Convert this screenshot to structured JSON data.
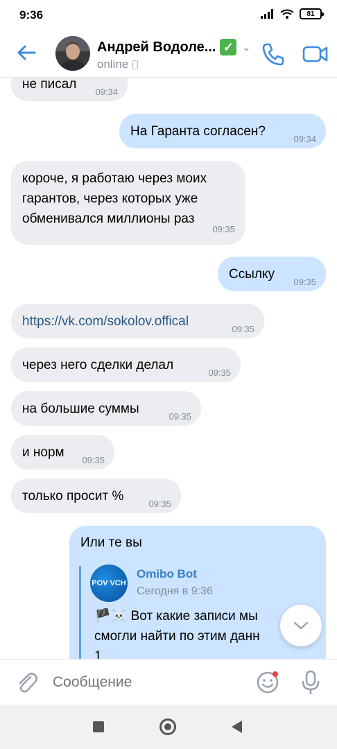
{
  "status_bar": {
    "time": "9:36",
    "battery": "81"
  },
  "header": {
    "name": "Андрей Водоле...",
    "verified_icon": "✅",
    "presence": "online"
  },
  "messages": [
    {
      "dir": "in",
      "text": "не писал",
      "time": "09:34"
    },
    {
      "dir": "out",
      "text": "На Гаранта согласен?",
      "time": "09:34"
    },
    {
      "dir": "in",
      "lines": [
        "короче, я работаю через моих",
        "гарантов, через которых уже",
        "обменивался миллионы раз"
      ],
      "time": "09:35"
    },
    {
      "dir": "out",
      "text": "Ссылку",
      "time": "09:35"
    },
    {
      "dir": "in",
      "text": "https://vk.com/sokolov.offical",
      "time": "09:35",
      "is_link": true
    },
    {
      "dir": "in",
      "text": "через него сделки делал",
      "time": "09:35"
    },
    {
      "dir": "in",
      "text": "на большие суммы",
      "time": "09:35"
    },
    {
      "dir": "in",
      "text": "и норм",
      "time": "09:35"
    },
    {
      "dir": "in",
      "text": "только просит %",
      "time": "09:35"
    }
  ],
  "forwarded": {
    "lead_text": "Или те вы",
    "bot_name": "Omibo Bot",
    "bot_avatar_text": "POV VCH",
    "date": "Сегодня в 9:36",
    "lines": [
      "🏴☠️ Вот какие записи мы",
      "смогли найти по этим данн",
      "1"
    ]
  },
  "composer": {
    "placeholder": "Сообщение"
  },
  "icons": {
    "back": "arrow-left-icon",
    "call": "phone-icon",
    "video": "video-camera-icon",
    "attach": "paperclip-icon",
    "sticker": "smiley-icon",
    "mic": "microphone-icon",
    "scroll": "chevron-down-icon"
  },
  "colors": {
    "accent": "#3f8ae0",
    "incoming_bubble": "#ebedf0",
    "outgoing_bubble": "#cce4ff",
    "link": "#2a5885"
  }
}
